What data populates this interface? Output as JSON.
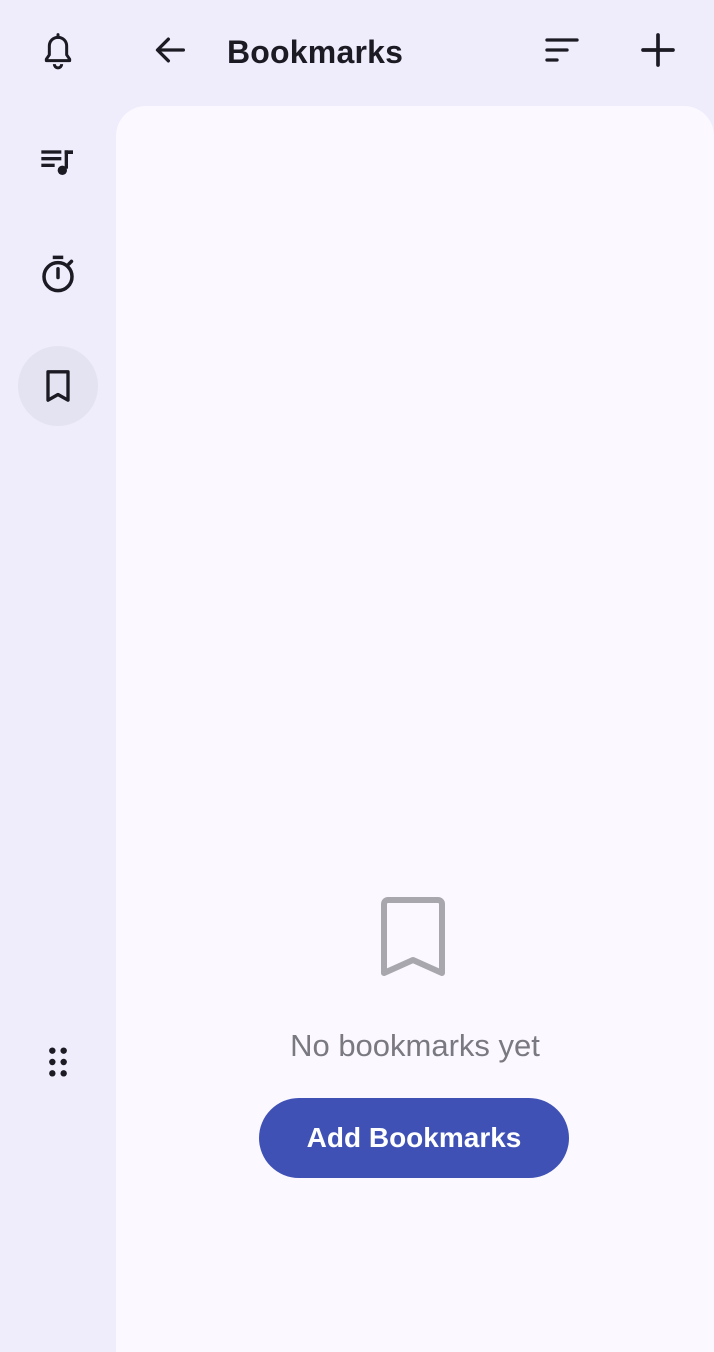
{
  "header": {
    "title": "Bookmarks"
  },
  "rail": {
    "items": [
      {
        "icon": "bell-icon"
      },
      {
        "icon": "playlist-music-icon"
      },
      {
        "icon": "timer-icon"
      },
      {
        "icon": "bookmark-icon",
        "active": true
      }
    ],
    "more_icon": "drag-dots-icon"
  },
  "empty_state": {
    "icon": "bookmark-outline-icon",
    "message": "No bookmarks yet",
    "button_label": "Add Bookmarks"
  },
  "colors": {
    "accent": "#3f51b5",
    "background": "#efedfb",
    "surface": "#fbf8ff",
    "rail_active": "#e4e3f2",
    "muted_text": "#7a7880",
    "icon_dark": "#1c1b24"
  }
}
